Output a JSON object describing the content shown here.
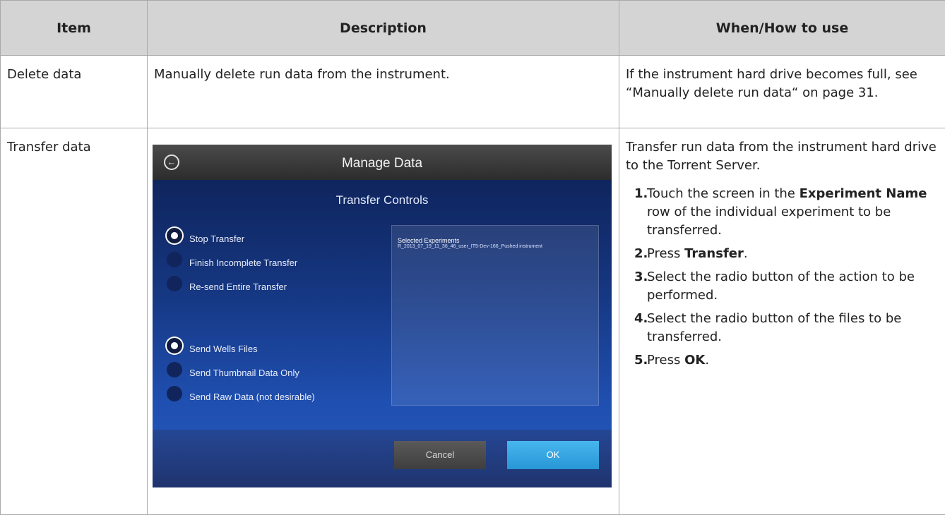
{
  "table": {
    "headers": [
      "Item",
      "Description",
      "When/How to use"
    ],
    "rows": [
      {
        "item": "Delete data",
        "description": "Manually delete run data from the instrument.",
        "how_to_use": "If the instrument hard drive becomes full, see “Manually delete run data“ on page 31."
      },
      {
        "item": "Transfer data",
        "how_to_use_intro": "Transfer run data from the instrument hard drive to the Torrent Server.",
        "steps": [
          {
            "num": "1.",
            "pre": "Touch the screen in the ",
            "bold": "Experiment Name",
            "post": " row of the individual experiment to be transferred."
          },
          {
            "num": "2.",
            "pre": "Press ",
            "bold": "Transfer",
            "post": "."
          },
          {
            "num": "3.",
            "pre": "Select the radio button of the action to be performed.",
            "bold": "",
            "post": ""
          },
          {
            "num": "4.",
            "pre": "Select the radio button of the files to be transferred.",
            "bold": "",
            "post": ""
          },
          {
            "num": "5.",
            "pre": "Press ",
            "bold": "OK",
            "post": "."
          }
        ]
      }
    ]
  },
  "screenshot": {
    "title": "Manage Data",
    "section_title": "Transfer Controls",
    "action_options": [
      {
        "label": "Stop Transfer",
        "selected": true
      },
      {
        "label": "Finish Incomplete Transfer",
        "selected": false
      },
      {
        "label": "Re-send Entire Transfer",
        "selected": false
      }
    ],
    "file_options": [
      {
        "label": "Send Wells Files",
        "selected": true
      },
      {
        "label": "Send Thumbnail Data Only",
        "selected": false
      },
      {
        "label": "Send Raw Data (not desirable)",
        "selected": false
      }
    ],
    "selected_panel_title": "Selected Experiments",
    "selected_panel_text": "R_2013_07_19_11_36_46_user_IT5-Dev-166_Pushed instrument",
    "cancel_label": "Cancel",
    "ok_label": "OK",
    "back_icon": "back-arrow-circle-icon"
  }
}
